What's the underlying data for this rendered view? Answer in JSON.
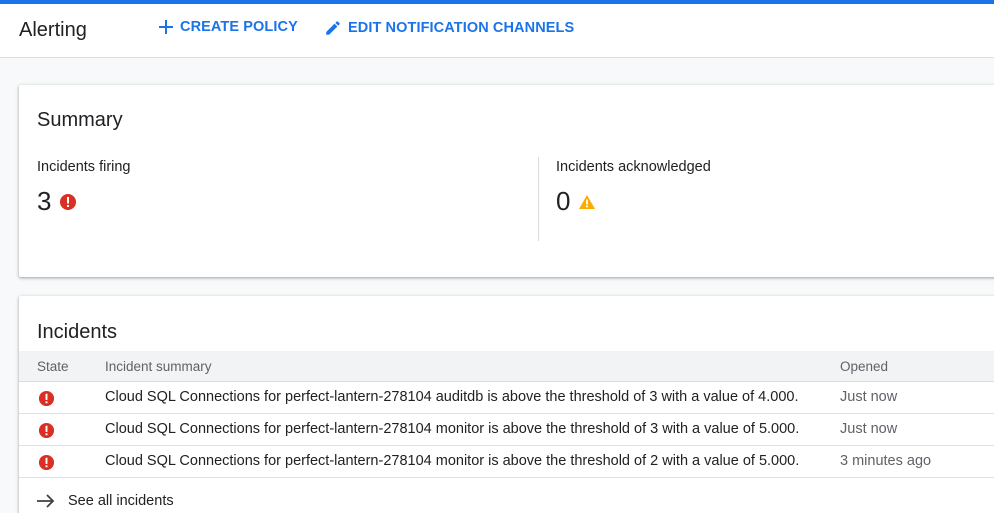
{
  "header": {
    "title": "Alerting",
    "create_policy_label": "CREATE POLICY",
    "edit_channels_label": "EDIT NOTIFICATION CHANNELS"
  },
  "summary": {
    "title": "Summary",
    "firing": {
      "label": "Incidents firing",
      "count": "3",
      "icon": "error-icon"
    },
    "acknowledged": {
      "label": "Incidents acknowledged",
      "count": "0",
      "icon": "warning-icon"
    }
  },
  "incidents": {
    "title": "Incidents",
    "columns": {
      "state": "State",
      "summary": "Incident summary",
      "opened": "Opened"
    },
    "rows": [
      {
        "state_icon": "error-icon",
        "summary": "Cloud SQL Connections for perfect-lantern-278104 auditdb is above the threshold of 3 with a value of 4.000.",
        "opened": "Just now"
      },
      {
        "state_icon": "error-icon",
        "summary": "Cloud SQL Connections for perfect-lantern-278104 monitor is above the threshold of 3 with a value of 5.000.",
        "opened": "Just now"
      },
      {
        "state_icon": "error-icon",
        "summary": "Cloud SQL Connections for perfect-lantern-278104 monitor is above the threshold of 2 with a value of 5.000.",
        "opened": "3 minutes ago"
      }
    ],
    "see_all_label": "See all incidents"
  },
  "colors": {
    "accent": "#1a73e8",
    "error": "#d93025",
    "warning": "#f9ab00"
  }
}
